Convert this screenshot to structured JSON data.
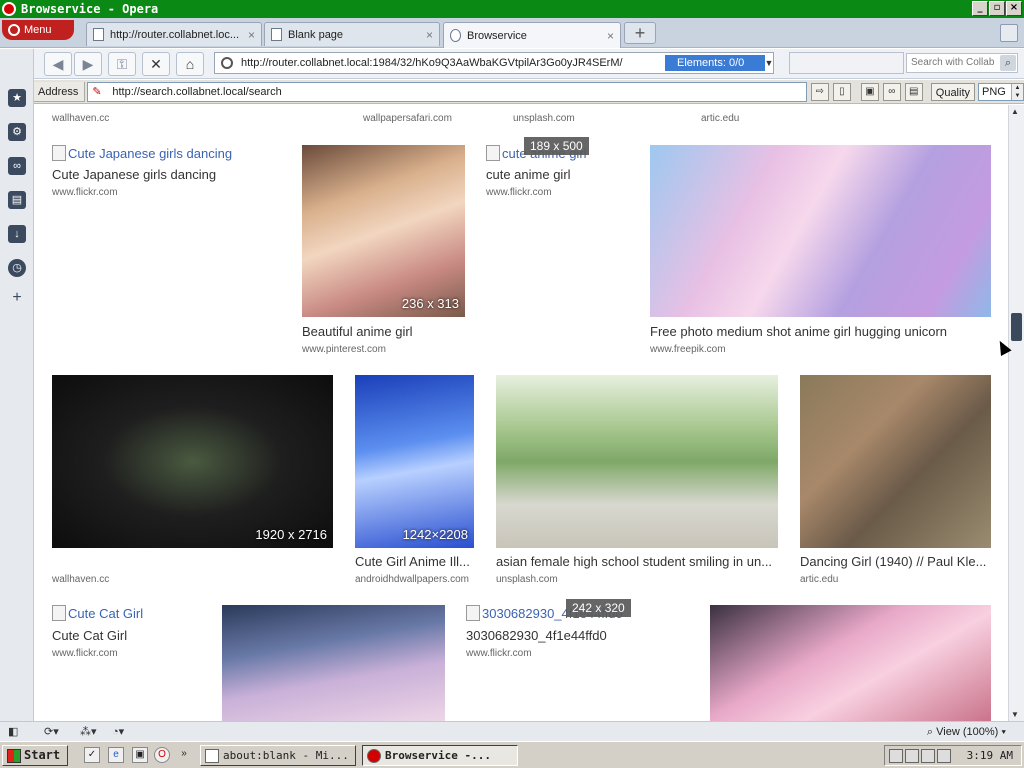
{
  "window": {
    "title": "Browservice - Opera",
    "buttons": [
      "_",
      "▫",
      "×"
    ]
  },
  "menu": {
    "label": "Menu"
  },
  "tabs": [
    {
      "label": "http://router.collabnet.loc...",
      "active": false
    },
    {
      "label": "Blank page",
      "active": false
    },
    {
      "label": "Browservice",
      "active": true
    }
  ],
  "nav": {
    "url": "http://router.collabnet.local:1984/32/hKo9Q3AaWbaKGVtpilAr3Go0yJR4SErM/",
    "elements_label": "Elements: 0/0",
    "search_placeholder": "Search with Collab"
  },
  "addressbar": {
    "label": "Address",
    "url": "http://search.collabnet.local/search",
    "quality_label": "Quality",
    "format": "PNG"
  },
  "results": {
    "top_sources": [
      "wallhaven.cc",
      "wallpapersafari.com",
      "unsplash.com",
      "artic.edu"
    ],
    "items": [
      {
        "title": "Cute Japanese girls dancing",
        "alt": "Cute Japanese girls dancing",
        "source": "www.flickr.com",
        "broken": true
      },
      {
        "title": "Beautiful anime girl",
        "source": "www.pinterest.com",
        "dims": "236 x 313"
      },
      {
        "title": "cute anime girl",
        "alt": "cute anime girl",
        "source": "www.flickr.com",
        "broken": true,
        "tip": "189 x 500"
      },
      {
        "title": "Free photo medium shot anime girl hugging unicorn",
        "source": "www.freepik.com"
      },
      {
        "title": "",
        "source": "wallhaven.cc",
        "dims": "1920 x 2716"
      },
      {
        "title": "Cute Girl Anime Ill...",
        "source": "androidhdwallpapers.com",
        "dims": "1242×2208"
      },
      {
        "title": "asian female high school student smiling in un...",
        "source": "unsplash.com"
      },
      {
        "title": "Dancing Girl (1940) // Paul Kle...",
        "source": "artic.edu"
      },
      {
        "title": "Cute Cat Girl",
        "alt": "Cute Cat Girl",
        "source": "www.flickr.com",
        "broken": true
      },
      {
        "title": "3030682930_4f1e44ffd0",
        "alt": "3030682930_4f1e44ffd0",
        "source": "www.flickr.com",
        "broken": true,
        "tip": "242 x 320"
      }
    ]
  },
  "statusbar": {
    "zoom": "View (100%)"
  },
  "taskbar": {
    "start": "Start",
    "tasks": [
      "about:blank - Mi...",
      "Browservice -..."
    ],
    "clock": "3:19 AM"
  }
}
